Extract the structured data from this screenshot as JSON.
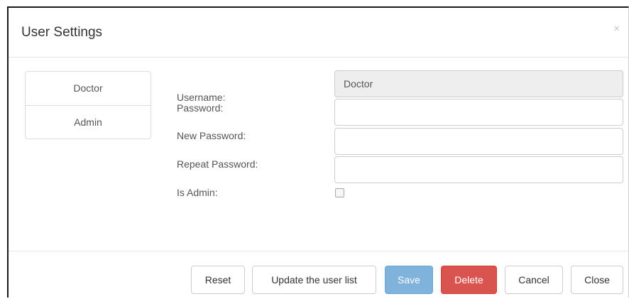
{
  "dialog": {
    "title": "User Settings",
    "close_glyph": "×"
  },
  "user_list": {
    "items": [
      {
        "label": "Doctor"
      },
      {
        "label": "Admin"
      }
    ]
  },
  "form": {
    "username": {
      "label": "Username:",
      "value": "Doctor"
    },
    "password": {
      "label": "Password:",
      "value": ""
    },
    "new_password": {
      "label": "New Password:",
      "value": ""
    },
    "repeat_password": {
      "label": "Repeat Password:",
      "value": ""
    },
    "is_admin": {
      "label": "Is Admin:",
      "checked": false
    }
  },
  "footer": {
    "reset_label": "Reset",
    "update_label": "Update the user list",
    "save_label": "Save",
    "delete_label": "Delete",
    "cancel_label": "Cancel",
    "close_label": "Close"
  },
  "colors": {
    "primary": "#7fb3db",
    "danger": "#d9534f",
    "readonly_bg": "#eeeeee"
  }
}
